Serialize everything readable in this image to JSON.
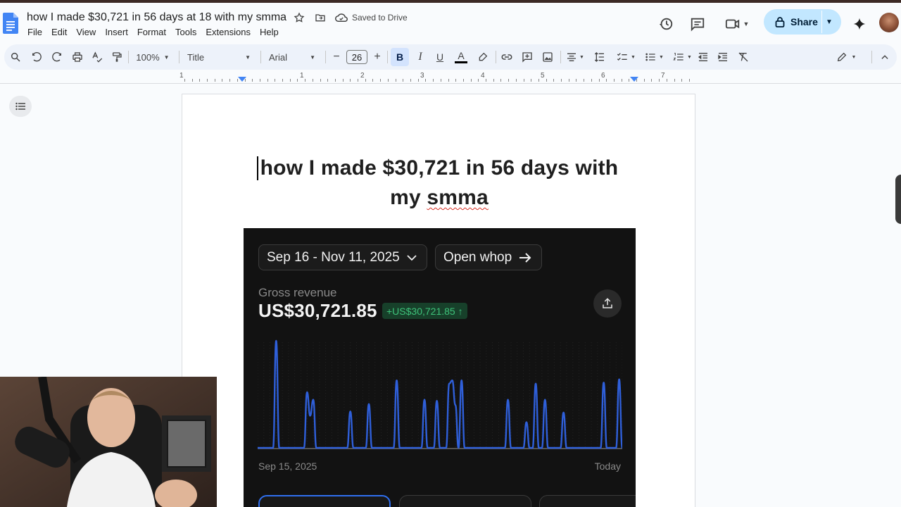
{
  "document": {
    "title": "how I made $30,721 in 56 days at 18 with my smma",
    "saved_status": "Saved to Drive"
  },
  "menu": [
    "File",
    "Edit",
    "View",
    "Insert",
    "Format",
    "Tools",
    "Extensions",
    "Help"
  ],
  "header": {
    "share_label": "Share"
  },
  "toolbar": {
    "zoom": "100%",
    "style": "Title",
    "font": "Arial",
    "font_size": "26",
    "minus": "−",
    "plus": "+",
    "bold": "B",
    "italic": "I",
    "underline": "U",
    "text_color": "A"
  },
  "ruler": {
    "numbers": [
      "1",
      "1",
      "2",
      "3",
      "4",
      "5",
      "6",
      "7"
    ]
  },
  "doc_body": {
    "heading_line1": "how I made $30,721 in 56 days with",
    "heading_line2_plain": "my ",
    "heading_line2_misspelled": "smma"
  },
  "dashboard": {
    "date_range": "Sep 16 - Nov 11, 2025",
    "open_button": "Open whop",
    "gross_label": "Gross revenue",
    "gross_value": "US$30,721.85",
    "change_badge": "+US$30,721.85 ↑",
    "axis_start": "Sep 15, 2025",
    "axis_end": "Today"
  },
  "chart_data": {
    "type": "line",
    "xlabel": "",
    "ylabel": "",
    "x_start": "Sep 15, 2025",
    "x_end": "Today",
    "series": [
      {
        "values": [
          0,
          0,
          0,
          0,
          0,
          0,
          1.0,
          0,
          0,
          0,
          0,
          0,
          0,
          0,
          0,
          0,
          0.52,
          0.3,
          0.45,
          0,
          0,
          0,
          0,
          0,
          0,
          0,
          0,
          0,
          0,
          0,
          0.34,
          0,
          0,
          0,
          0,
          0,
          0.41,
          0,
          0,
          0,
          0,
          0,
          0,
          0,
          0,
          0.63,
          0,
          0,
          0,
          0,
          0,
          0,
          0,
          0,
          0.45,
          0,
          0,
          0,
          0.44,
          0,
          0,
          0,
          0.6,
          0.63,
          0.4,
          0,
          0.63,
          0,
          0,
          0,
          0,
          0,
          0,
          0,
          0,
          0,
          0,
          0,
          0,
          0,
          0,
          0.45,
          0,
          0,
          0,
          0,
          0,
          0.24,
          0,
          0,
          0.6,
          0,
          0,
          0.45,
          0,
          0,
          0,
          0,
          0,
          0.33,
          0,
          0,
          0,
          0,
          0,
          0,
          0,
          0,
          0,
          0,
          0,
          0,
          0.61,
          0,
          0,
          0,
          0,
          0.64,
          0
        ]
      }
    ],
    "colors": {
      "line": "#2f5fd9",
      "background": "#121212"
    },
    "grid": false
  },
  "colors": {
    "accent": "#0b57d0",
    "share_bg": "#c2e7ff",
    "toolbar_bg": "#edf2fa",
    "badge_text": "#3ec27a",
    "badge_bg": "#17402a"
  },
  "icons": {
    "webcam_overlay": "presenter-webcam"
  }
}
